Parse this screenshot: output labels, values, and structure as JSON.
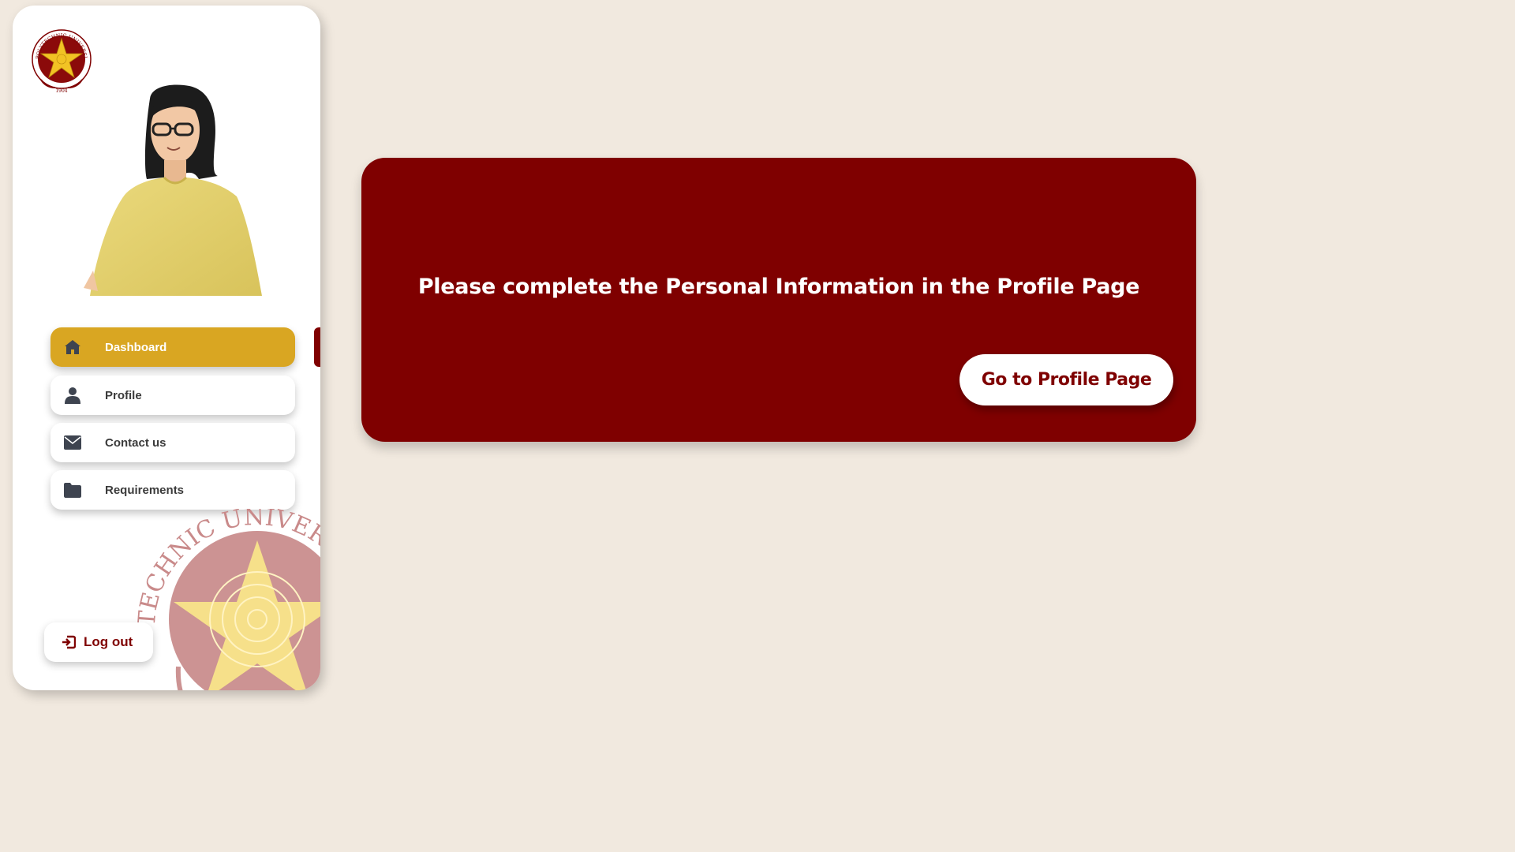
{
  "app": {
    "logo_alt": "Polytechnic University of the Philippines seal",
    "logo_text": "POLYTECHNIC UNIVERSITY OF THE PHILIPPINES",
    "logo_year": "1904",
    "watermark_text": "TECHNIC UNIVERSITY OF THE"
  },
  "sidebar": {
    "items": [
      {
        "label": "Dashboard",
        "icon": "home-icon",
        "active": true
      },
      {
        "label": "Profile",
        "icon": "user-icon",
        "active": false
      },
      {
        "label": "Contact us",
        "icon": "envelope-icon",
        "active": false
      },
      {
        "label": "Requirements",
        "icon": "folder-icon",
        "active": false
      }
    ],
    "logout_label": "Log out"
  },
  "main": {
    "message": "Please complete the Personal Information in the Profile Page",
    "button_label": "Go to Profile Page"
  },
  "colors": {
    "maroon": "#7f0000",
    "gold": "#d9a622",
    "background": "#f1e9df"
  }
}
